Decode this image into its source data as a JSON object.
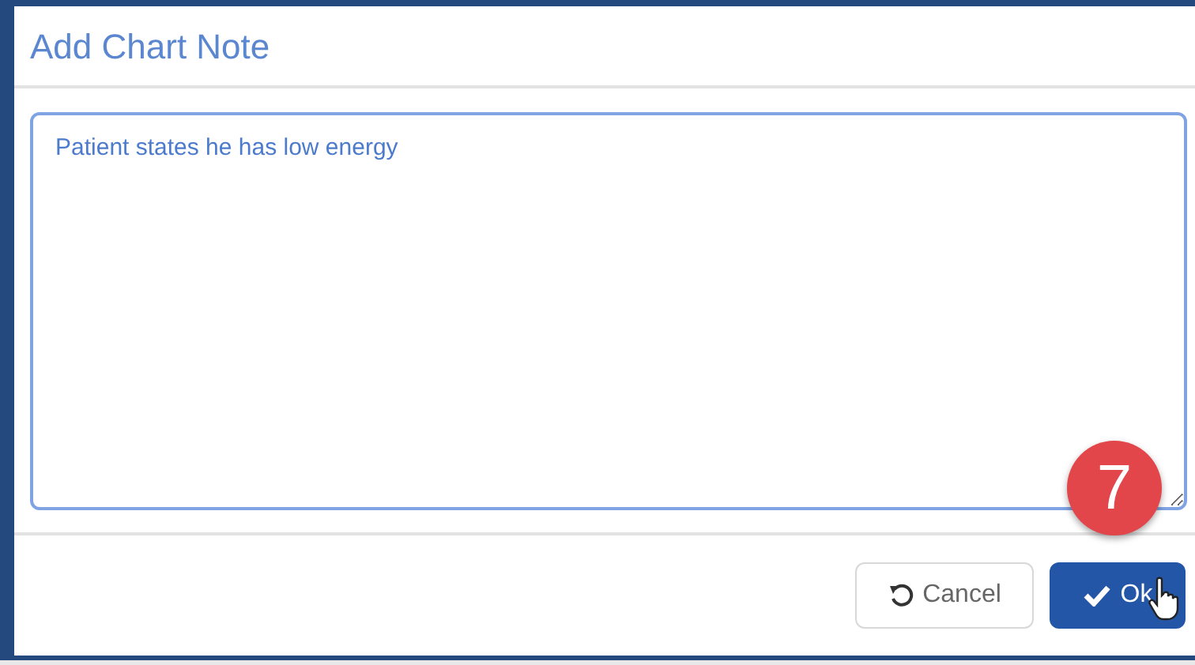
{
  "dialog": {
    "title": "Add Chart Note"
  },
  "note": {
    "value": "Patient states he has low energy"
  },
  "step_badge": "7",
  "buttons": [
    {
      "kind": "cancel",
      "label": "Cancel"
    },
    {
      "kind": "ok",
      "label": "Ok"
    }
  ]
}
